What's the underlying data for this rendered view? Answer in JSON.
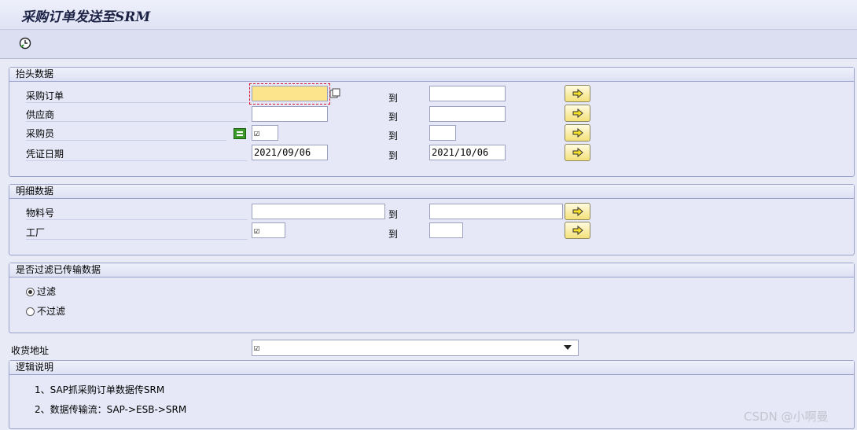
{
  "window": {
    "title": "采购订单发送至SRM"
  },
  "toolbar": {
    "execute_icon": "execute-clock-icon"
  },
  "header_group": {
    "title": "抬头数据",
    "to_label": "到",
    "rows": [
      {
        "label": "采购订单",
        "from": "",
        "to": ""
      },
      {
        "label": "供应商",
        "from": "",
        "to": ""
      },
      {
        "label": "采购员",
        "from": "☑",
        "to": ""
      },
      {
        "label": "凭证日期",
        "from": "2021/09/06",
        "to": "2021/10/06"
      }
    ]
  },
  "detail_group": {
    "title": "明细数据",
    "to_label": "到",
    "rows": [
      {
        "label": "物料号",
        "from": "",
        "to": ""
      },
      {
        "label": "工厂",
        "from": "☑",
        "to": ""
      }
    ]
  },
  "filter_group": {
    "title": "是否过滤已传输数据",
    "options": [
      {
        "label": "过滤",
        "selected": true
      },
      {
        "label": "不过滤",
        "selected": false
      }
    ]
  },
  "delivery": {
    "label": "收货地址",
    "value": "☑"
  },
  "logic_group": {
    "title": "逻辑说明",
    "lines": [
      "1、SAP抓采购订单数据传SRM",
      "2、数据传输流：SAP->ESB->SRM"
    ]
  },
  "watermark": "CSDN @小啊曼",
  "colors": {
    "accent_yellow": "#f4e17a",
    "active_field": "#fbe48c",
    "frame": "#9aa2cc"
  }
}
